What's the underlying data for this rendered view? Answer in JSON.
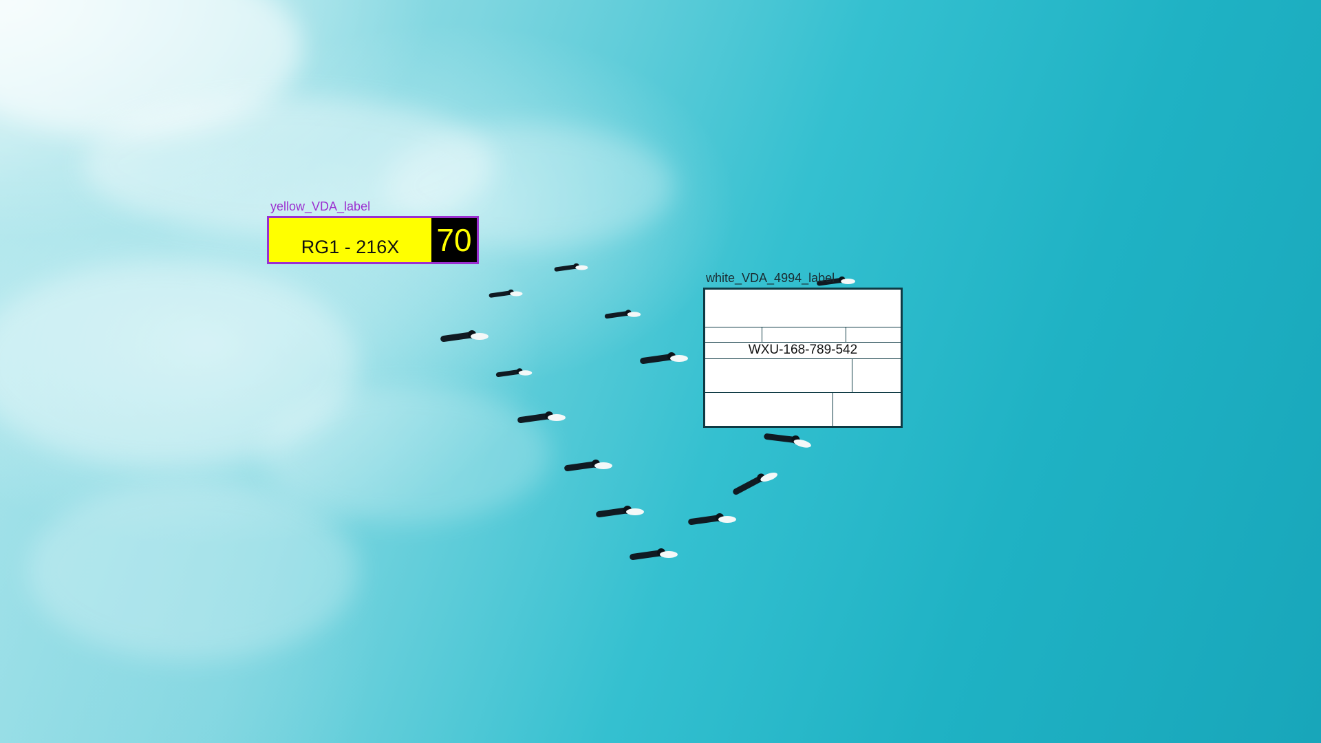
{
  "labels": {
    "yellow": {
      "caption": "yellow_VDA_label",
      "code": "RG1 - 216X",
      "number": "70",
      "colors": {
        "background": "#ffff00",
        "border": "#9b30d0",
        "number_bg": "#000000",
        "number_fg": "#ffff00"
      }
    },
    "white": {
      "caption": "white_VDA_4994_label",
      "code": "WXU-168-789-542",
      "colors": {
        "background": "#ffffff",
        "border": "#0e3a44"
      }
    }
  },
  "scene": {
    "description_colors": {
      "water_light": "#b8e9ee",
      "water_deep": "#18a6ba",
      "foam": "#ffffff"
    }
  }
}
